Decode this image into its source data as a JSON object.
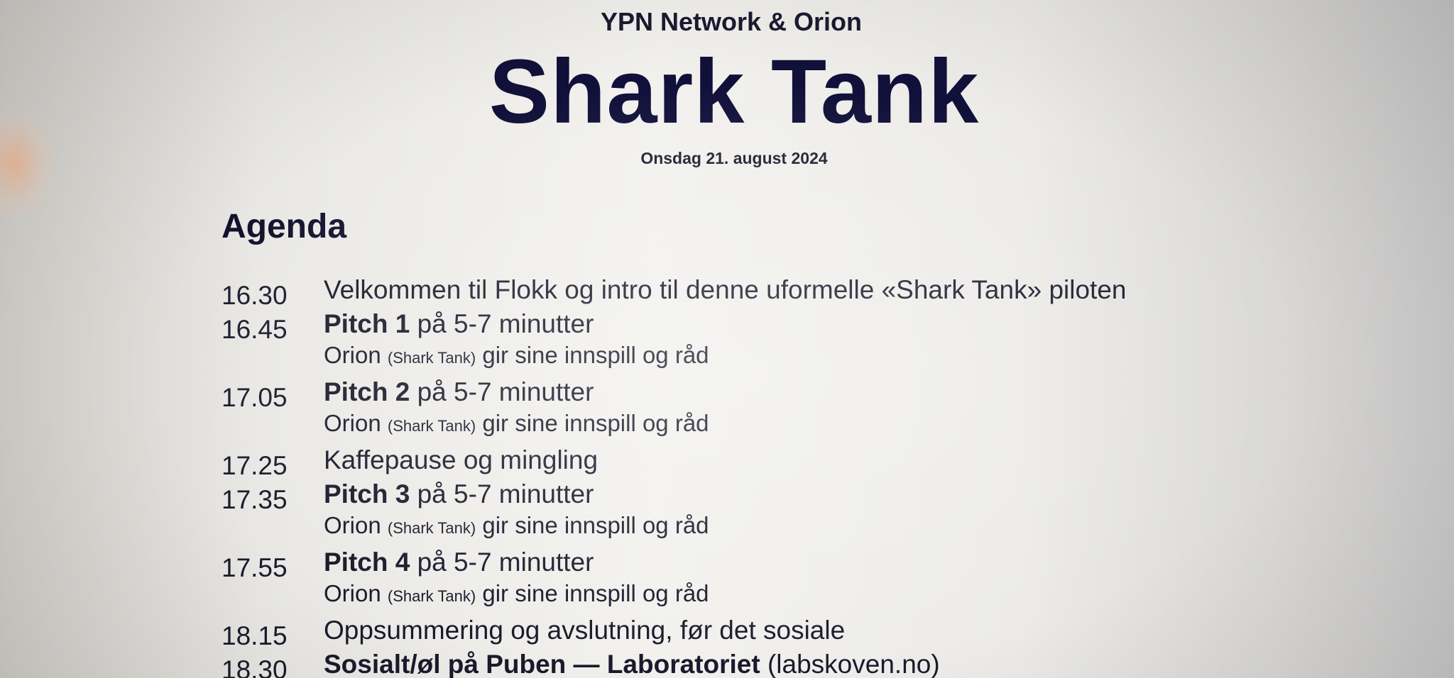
{
  "header": {
    "organizer": "YPN Network & Orion",
    "title": "Shark Tank",
    "date": "Onsdag 21. august 2024"
  },
  "agenda": {
    "heading": "Agenda",
    "items": [
      {
        "time": "16.30",
        "text": "Velkommen til Flokk og intro til denne uformelle «Shark Tank» piloten"
      },
      {
        "time": "16.45",
        "bold": "Pitch 1",
        "rest": " på 5-7 minutter",
        "feedback": {
          "who": "Orion ",
          "note": "(Shark Tank)",
          "rest": " gir sine innspill og råd"
        }
      },
      {
        "time": "17.05",
        "bold": "Pitch 2",
        "rest": " på 5-7 minutter",
        "feedback": {
          "who": "Orion ",
          "note": "(Shark Tank)",
          "rest": " gir sine innspill og råd"
        }
      },
      {
        "time": "17.25",
        "text": "Kaffepause og mingling"
      },
      {
        "time": "17.35",
        "bold": "Pitch 3",
        "rest": " på 5-7 minutter",
        "feedback": {
          "who": "Orion ",
          "note": "(Shark Tank)",
          "rest": " gir sine innspill og råd"
        }
      },
      {
        "time": "17.55",
        "bold": "Pitch 4",
        "rest": " på 5-7 minutter",
        "feedback": {
          "who": "Orion ",
          "note": "(Shark Tank)",
          "rest": " gir sine innspill og råd"
        }
      },
      {
        "time": "18.15",
        "text": "Oppsummering og avslutning, før det sosiale"
      },
      {
        "time": "18.30",
        "bold": "Sosialt/øl på Puben — Laboratoriet",
        "rest": " (labskoven.no)"
      }
    ]
  }
}
